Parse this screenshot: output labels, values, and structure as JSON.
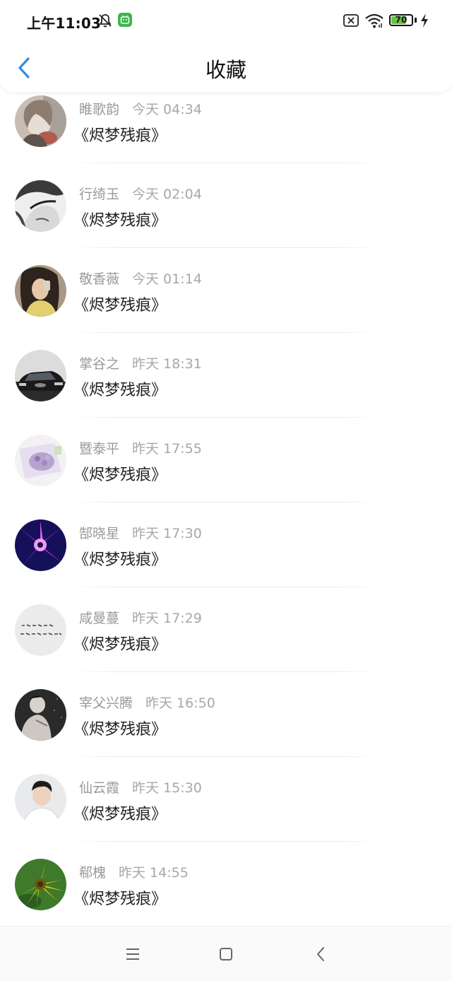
{
  "status_bar": {
    "time": "上午11:03",
    "battery_level": "70",
    "icons": [
      "bell-muted-icon",
      "app-notification-icon",
      "sim-blocked-icon",
      "wifi-icon",
      "battery-icon",
      "charging-bolt-icon"
    ]
  },
  "header": {
    "title": "收藏",
    "back_icon": "chevron-left-icon",
    "accent_color": "#2f8ce8"
  },
  "list": [
    {
      "name": "睢歌韵",
      "time": "今天 04:34",
      "content": "《烬梦残痕》",
      "avatar": "avatar-girl-sketch"
    },
    {
      "name": "行绮玉",
      "time": "今天 02:04",
      "content": "《烬梦残痕》",
      "avatar": "avatar-bw-face"
    },
    {
      "name": "敬香薇",
      "time": "今天 01:14",
      "content": "《烬梦残痕》",
      "avatar": "avatar-girl-photo"
    },
    {
      "name": "掌谷之",
      "time": "昨天 18:31",
      "content": "《烬梦残痕》",
      "avatar": "avatar-black-car"
    },
    {
      "name": "暨泰平",
      "time": "昨天 17:55",
      "content": "《烬梦残痕》",
      "avatar": "avatar-purple-flowers"
    },
    {
      "name": "郜晓星",
      "time": "昨天 17:30",
      "content": "《烬梦残痕》",
      "avatar": "avatar-purple-bloom"
    },
    {
      "name": "咸曼蔓",
      "time": "昨天 17:29",
      "content": "《烬梦残痕》",
      "avatar": "avatar-handwriting"
    },
    {
      "name": "宰父兴腾",
      "time": "昨天 16:50",
      "content": "《烬梦残痕》",
      "avatar": "avatar-man-dark"
    },
    {
      "name": "仙云霞",
      "time": "昨天 15:30",
      "content": "《烬梦残痕》",
      "avatar": "avatar-young-man"
    },
    {
      "name": "郗槐",
      "time": "昨天 14:55",
      "content": "《烬梦残痕》",
      "avatar": "avatar-yellow-flower"
    }
  ],
  "nav_bar": {
    "icons": [
      "menu-icon",
      "home-square-icon",
      "back-triangle-icon"
    ]
  }
}
